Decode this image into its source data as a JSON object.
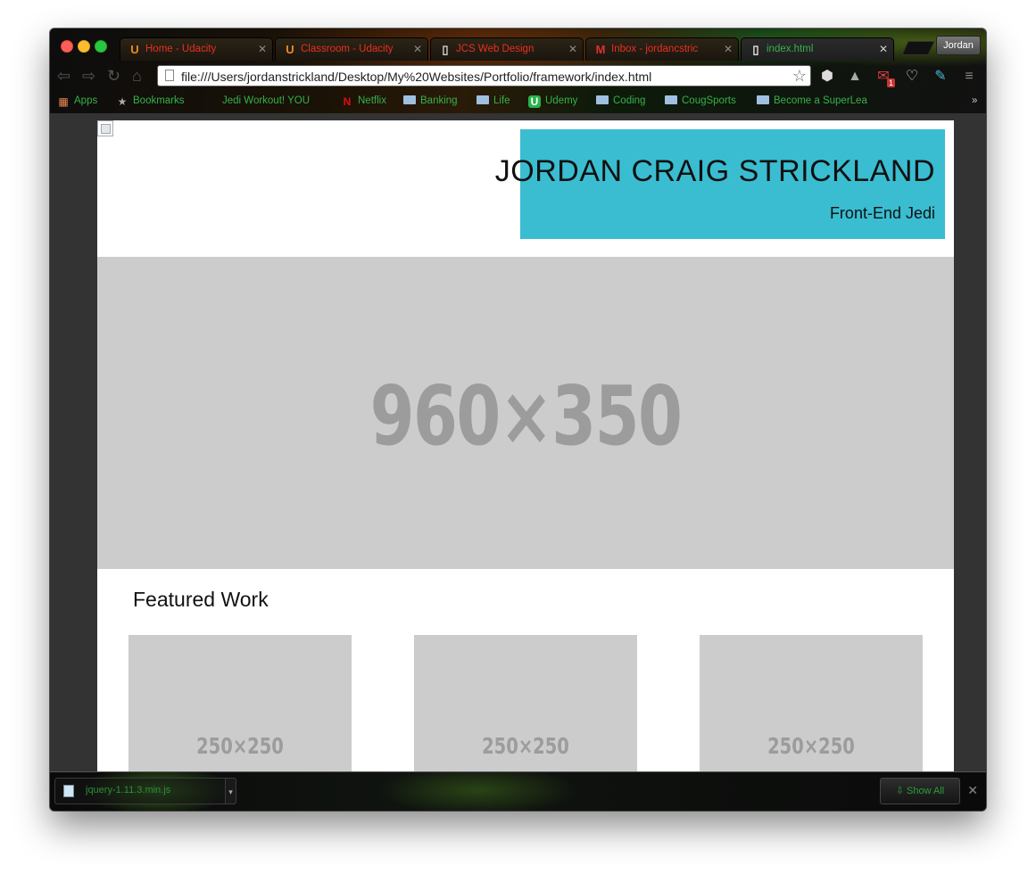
{
  "browser": {
    "tabs": [
      {
        "title": "Home - Udacity",
        "icon": "udacity-icon",
        "active": false
      },
      {
        "title": "Classroom - Udacity",
        "icon": "udacity-icon",
        "active": false
      },
      {
        "title": "JCS Web Design",
        "icon": "page-icon",
        "active": false
      },
      {
        "title": "Inbox - jordancstric",
        "icon": "gmail-icon",
        "active": false
      },
      {
        "title": "index.html",
        "icon": "page-icon",
        "active": true
      }
    ],
    "profile_label": "Jordan",
    "url": "file:///Users/jordanstrickland/Desktop/My%20Websites/Portfolio/framework/index.html",
    "gmail_badge": "1",
    "bookmarks": [
      {
        "label": "Apps",
        "icon": "apps-grid-icon"
      },
      {
        "label": "Bookmarks",
        "icon": "star-icon"
      },
      {
        "label": "Jedi Workout! YOU",
        "icon": "none"
      },
      {
        "label": "Netflix",
        "icon": "netflix-icon"
      },
      {
        "label": "Banking",
        "icon": "folder-icon"
      },
      {
        "label": "Life",
        "icon": "folder-icon"
      },
      {
        "label": "Udemy",
        "icon": "udemy-icon"
      },
      {
        "label": "Coding",
        "icon": "folder-icon"
      },
      {
        "label": "CougSports",
        "icon": "folder-icon"
      },
      {
        "label": "Become a SuperLea",
        "icon": "folder-icon"
      }
    ],
    "overflow_label": "»"
  },
  "page": {
    "site_title": "JORDAN CRAIG STRICKLAND",
    "site_subtitle": "Front-End Jedi",
    "hero_label": "960×350",
    "section_title": "Featured Work",
    "thumbs": [
      {
        "label": "250×250"
      },
      {
        "label": "250×250"
      },
      {
        "label": "250×250"
      }
    ]
  },
  "downloads": {
    "file_name": "jquery-1.11.3.min.js",
    "show_all_label": "Show All"
  },
  "colors": {
    "accent_title_box": "#3abdd1",
    "placeholder_gray": "#cccccc",
    "tab_title_red": "#e83020",
    "active_green": "#34b24a"
  }
}
